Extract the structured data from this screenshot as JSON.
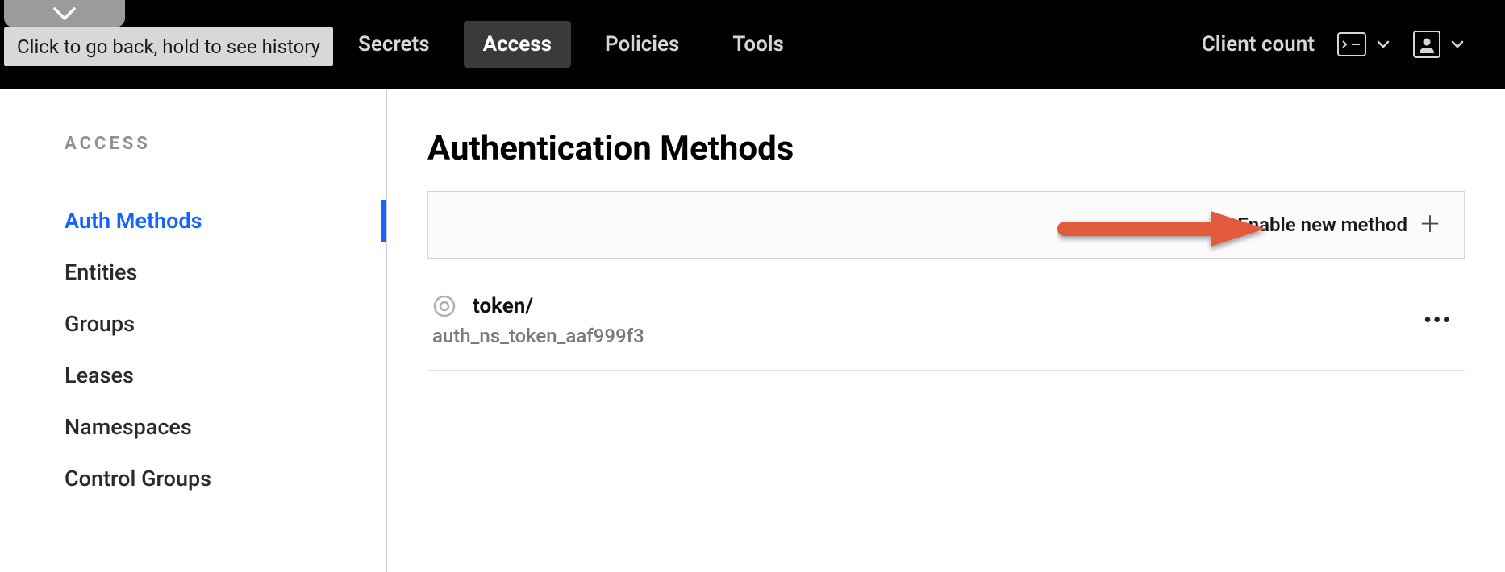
{
  "tooltip": {
    "text": "Click to go back, hold to see history"
  },
  "nav": {
    "items": [
      {
        "label": "Secrets",
        "active": false
      },
      {
        "label": "Access",
        "active": true
      },
      {
        "label": "Policies",
        "active": false
      },
      {
        "label": "Tools",
        "active": false
      }
    ],
    "client_count_label": "Client count"
  },
  "sidebar": {
    "heading": "ACCESS",
    "items": [
      {
        "label": "Auth Methods",
        "active": true
      },
      {
        "label": "Entities",
        "active": false
      },
      {
        "label": "Groups",
        "active": false
      },
      {
        "label": "Leases",
        "active": false
      },
      {
        "label": "Namespaces",
        "active": false
      },
      {
        "label": "Control Groups",
        "active": false
      }
    ]
  },
  "main": {
    "title": "Authentication Methods",
    "enable_label": "Enable new method",
    "methods": [
      {
        "name": "token/",
        "id": "auth_ns_token_aaf999f3"
      }
    ]
  }
}
